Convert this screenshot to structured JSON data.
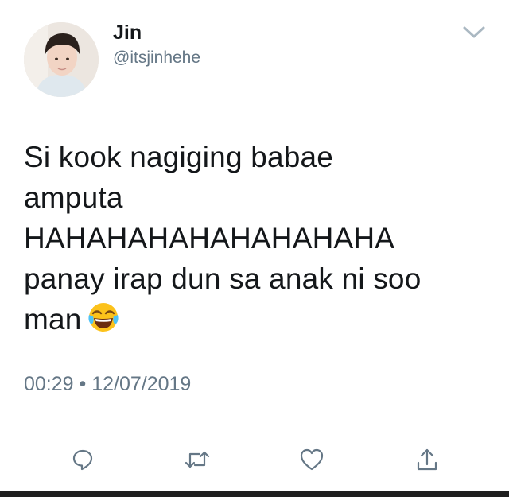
{
  "user": {
    "display_name": "Jin",
    "handle": "@itsjinhehe",
    "avatar": "profile-photo"
  },
  "tweet": {
    "lines": [
      "Si kook nagiging babae",
      "amputa",
      "HAHAHAHAHAHAHAHAHA",
      "panay irap dun sa anak ni soo",
      "man"
    ],
    "emoji": "face-with-tears-of-joy",
    "timestamp": "00:29 • 12/07/2019"
  },
  "actions": [
    {
      "name": "reply",
      "icon": "reply-icon"
    },
    {
      "name": "retweet",
      "icon": "retweet-icon"
    },
    {
      "name": "like",
      "icon": "heart-icon"
    },
    {
      "name": "share",
      "icon": "share-icon"
    }
  ],
  "colors": {
    "text": "#14171a",
    "secondary": "#657786",
    "icon": "#657786",
    "divider": "#e1e8ed"
  }
}
